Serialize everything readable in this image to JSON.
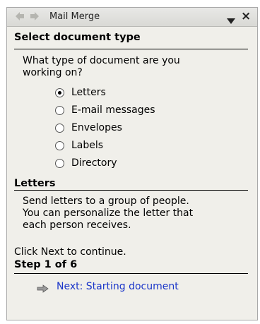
{
  "title": "Mail Merge",
  "section1": {
    "heading": "Select document type",
    "question_line1": "What type of document are you",
    "question_line2": "working on?",
    "options": [
      {
        "label": "Letters",
        "selected": true
      },
      {
        "label": "E-mail messages",
        "selected": false
      },
      {
        "label": "Envelopes",
        "selected": false
      },
      {
        "label": "Labels",
        "selected": false
      },
      {
        "label": "Directory",
        "selected": false
      }
    ]
  },
  "section2": {
    "heading": "Letters",
    "line1": "Send letters to a group of people.",
    "line2": "You can personalize the letter that",
    "line3": "each person receives."
  },
  "continue_text": "Click Next to continue.",
  "step": {
    "heading": "Step 1 of 6",
    "next_label": "Next: Starting document"
  },
  "colors": {
    "link": "#1a35c9",
    "pane_bg": "#f0efea"
  },
  "icons": [
    "back-arrow-icon",
    "forward-arrow-icon",
    "dropdown-arrow-icon",
    "close-icon",
    "next-arrow-icon"
  ]
}
